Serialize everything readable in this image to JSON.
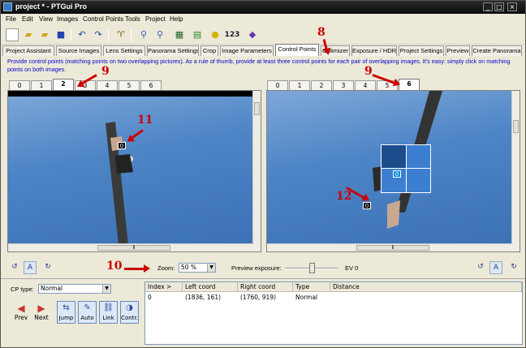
{
  "window": {
    "title": "project * - PTGui Pro"
  },
  "menu": [
    "File",
    "Edit",
    "View",
    "Images",
    "Control Points",
    "Tools",
    "Project",
    "Help"
  ],
  "toolbar": {
    "zoom_label": "123"
  },
  "main_tabs": [
    "Project Assistant",
    "Source Images",
    "Lens Settings",
    "Panorama Settings",
    "Crop",
    "Image Parameters",
    "Control Points",
    "Optimizer",
    "Exposure / HDR",
    "Project Settings",
    "Preview",
    "Create Panorama"
  ],
  "active_main_tab": "Control Points",
  "description": "Provide control points (matching points on two overlapping pictures). As a rule of thumb, provide at least three control points for each pair of overlapping images. It's easy: simply click on matching points on both images.",
  "left_tabs": [
    "0",
    "1",
    "2",
    "3",
    "4",
    "5",
    "6"
  ],
  "left_active": "2",
  "right_tabs": [
    "0",
    "1",
    "2",
    "3",
    "4",
    "5",
    "6"
  ],
  "right_active": "6",
  "left_pane": {
    "cp_label": "0"
  },
  "right_pane": {
    "cp_label": "0",
    "zoom_cp_label": "0"
  },
  "annotations": {
    "a8": "8",
    "a9_left": "9",
    "a9_right": "9",
    "a10": "10",
    "a11": "11",
    "a12": "12"
  },
  "controls": {
    "zoom_label": "Zoom:",
    "zoom_value": "50 %",
    "preview_exposure_label": "Preview exposure:",
    "preview_exposure_value": 0.5,
    "ev_label": "EV 0",
    "left_toggle": "A",
    "right_toggle": "A"
  },
  "cp_type": {
    "label": "CP type:",
    "value": "Normal"
  },
  "nav": {
    "prev": "Prev",
    "next": "Next"
  },
  "func_buttons": [
    "Jump",
    "Auto",
    "Link",
    "Contr."
  ],
  "table": {
    "headers": [
      "Index >",
      "Left coord",
      "Right coord",
      "Type",
      "Distance"
    ],
    "rows": [
      [
        "0",
        "(1836, 161)",
        "(1760, 919)",
        "Normal",
        ""
      ]
    ]
  },
  "colors": {
    "annotation": "#cc0000",
    "description_text": "#0000cc",
    "sky": "#4d85c6"
  }
}
